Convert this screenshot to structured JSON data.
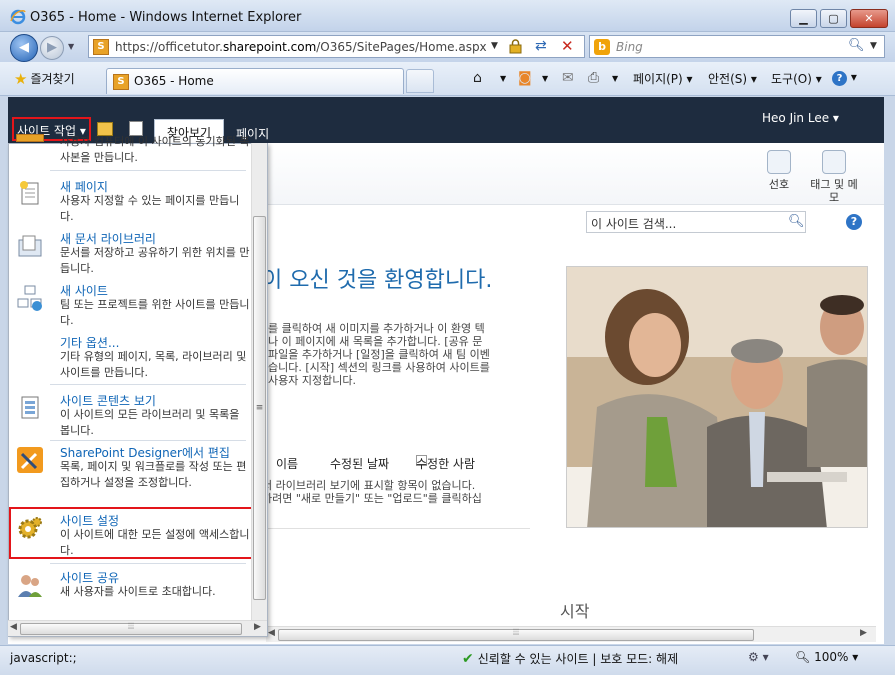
{
  "window": {
    "title": "O365 - Home - Windows Internet Explorer"
  },
  "address_bar": {
    "url_prefix": "https://officetutor.",
    "url_domain": "sharepoint.com",
    "url_path": "/O365/SitePages/Home.aspx",
    "search_placeholder": "Bing"
  },
  "favorites": {
    "label": "즐겨찾기",
    "tab_title": "O365 - Home"
  },
  "commands": {
    "page": "페이지(P)",
    "safety": "안전(S)",
    "tools": "도구(O)"
  },
  "sharepoint": {
    "site_actions": "사이트 작업",
    "tab_browse": "찾아보기",
    "tab_page": "페이지",
    "user_name": "Heo Jin Lee",
    "ribbon_like": "선호",
    "ribbon_tags": "태그 및 메모",
    "search_placeholder": "이 사이트 검색..."
  },
  "menu": {
    "partial_top": "사용자 컴퓨터에 이 사이트의 동기화된 복사본을 만듭니다.",
    "items": [
      {
        "title": "새 페이지",
        "desc": "사용자 지정할 수 있는 페이지를 만듭니다.",
        "icon": "new-page-icon"
      },
      {
        "title": "새 문서 라이브러리",
        "desc": "문서를 저장하고 공유하기 위한 위치를 만듭니다.",
        "icon": "document-library-icon"
      },
      {
        "title": "새 사이트",
        "desc": "팀 또는 프로젝트를 위한 사이트를 만듭니다.",
        "icon": "new-site-icon"
      },
      {
        "title": "기타 옵션...",
        "desc": "기타 유형의 페이지, 목록, 라이브러리 및 사이트를 만듭니다.",
        "icon": ""
      },
      {
        "title": "사이트 콘텐츠 보기",
        "desc": "이 사이트의 모든 라이브러리 및 목록을 봅니다.",
        "icon": "site-content-icon"
      },
      {
        "title": "SharePoint Designer에서 편집",
        "desc": "목록, 페이지 및 워크플로를 작성 또는 편집하거나 설정을 조정합니다.",
        "icon": "designer-icon"
      },
      {
        "title": "사이트 설정",
        "desc": "이 사이트에 대한 모든 설정에 액세스합니다.",
        "icon": "gear-icon"
      },
      {
        "title": "사이트 공유",
        "desc": "새 사용자를 사이트로 초대합니다.",
        "icon": "share-site-icon"
      }
    ]
  },
  "main": {
    "welcome": "이 사이트를 방문해 주셔서 감사합니다. 이 오신 것을 환영합니다.",
    "welcome_visible": "이 오신 것을 환영합니다.",
    "body_lines": [
      "를 클릭하여 새 이미지를 추가하거나 이 환영 텍",
      "나 이 페이지에 새 목록을 추가합니다. [공유 문",
      "파일을 추가하거나 [일정]을 클릭하여 새 팀 이벤",
      "습니다. [시작] 섹션의 링크를 사용하여 사이트를",
      "사용자 지정합니다."
    ],
    "col_name": "이름",
    "col_modified": "수정된 날짜",
    "col_modified_by": "수정한 사람",
    "empty_lines": [
      "서 라이브러리 보기에 표시할 항목이 없습니다.",
      "하려면 \"새로 만들기\" 또는 \"업로드\"를 클릭하십"
    ],
    "getting_started": "시작"
  },
  "status": {
    "left": "javascript:;",
    "zone": "신뢰할 수 있는 사이트 | 보호 모드: 해제",
    "zoom": "100%"
  },
  "colors": {
    "ribbon_dark": "#1e2c3f",
    "link_blue": "#0f65b6",
    "highlight_red": "#e3151a"
  }
}
